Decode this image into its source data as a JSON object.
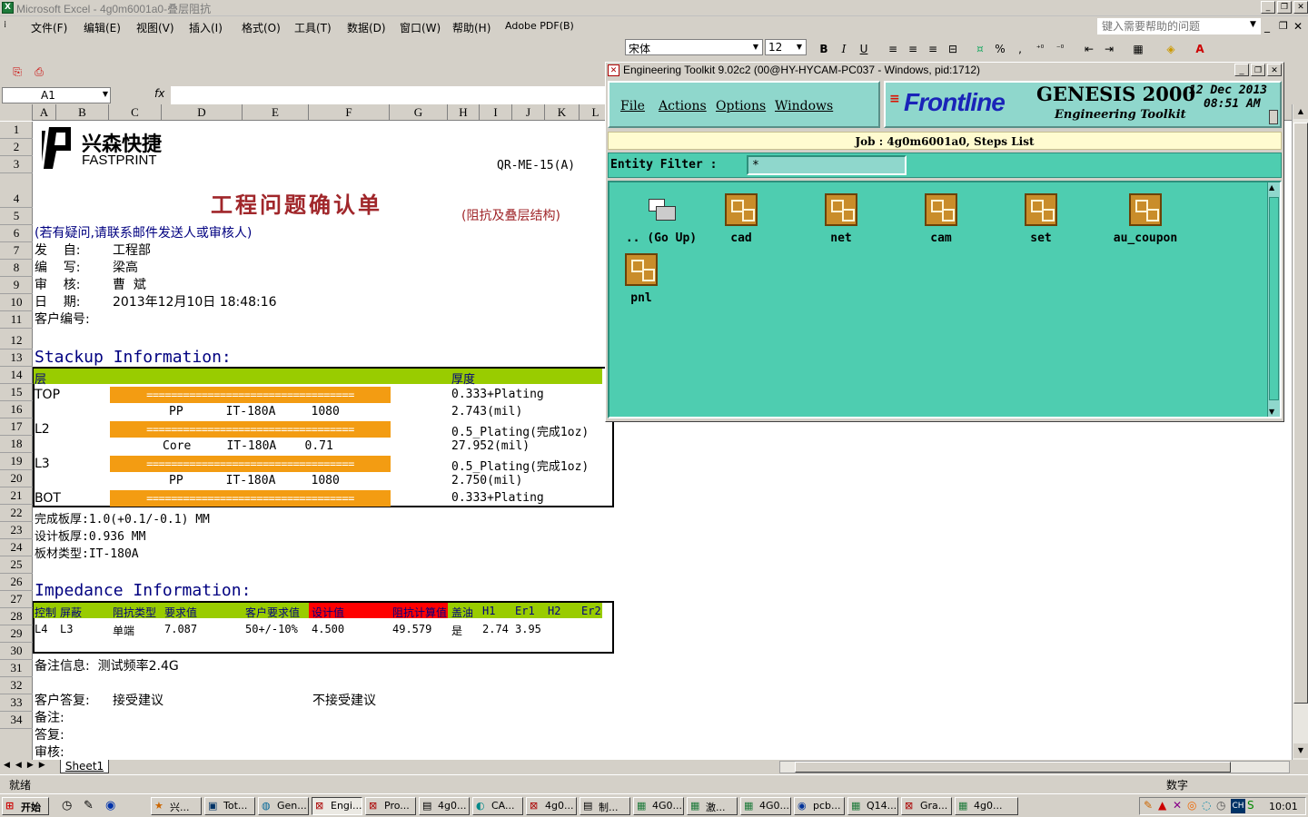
{
  "window": {
    "title": "Microsoft Excel - 4g0m6001a0-叠层阻抗",
    "icon": "excel-icon"
  },
  "menubar": {
    "items": [
      "文件(F)",
      "编辑(E)",
      "视图(V)",
      "插入(I)",
      "格式(O)",
      "工具(T)",
      "数据(D)",
      "窗口(W)",
      "帮助(H)",
      "Adobe PDF(B)"
    ],
    "help_placeholder": "键入需要帮助的问题"
  },
  "format_toolbar": {
    "font": "宋体",
    "size": "12",
    "bold": "B",
    "italic": "I",
    "underline": "U",
    "percent": "%",
    "comma": ","
  },
  "formula_bar": {
    "cell_ref": "A1",
    "fx": "fx",
    "formula": ""
  },
  "columns": [
    "A",
    "B",
    "C",
    "D",
    "E",
    "F",
    "G",
    "H",
    "I",
    "J",
    "K",
    "L"
  ],
  "rows": [
    "1",
    "2",
    "3",
    "4",
    "5",
    "6",
    "7",
    "8",
    "9",
    "10",
    "11",
    "12",
    "13",
    "14",
    "15",
    "16",
    "17",
    "18",
    "19",
    "20",
    "21",
    "22",
    "23",
    "24",
    "25",
    "26",
    "27",
    "28",
    "29",
    "30",
    "31",
    "32",
    "33",
    "34"
  ],
  "sheet": {
    "logo_cn": "兴森快捷",
    "logo_en": "FASTPRINT",
    "form_code": "QR-ME-15(A)",
    "doc_title": "工程问题确认单",
    "doc_subtitle": "(阻抗及叠层结构)",
    "note": "(若有疑问,请联系邮件发送人或审核人)",
    "from_label": "发    自:",
    "from_value": "工程部",
    "author_label": "编    写:",
    "author_value": "梁高",
    "reviewer_label": "审    核:",
    "reviewer_value": "曹  斌",
    "date_label": "日    期:",
    "date_value": "2013年12月10日 18:48:16",
    "customer_no_label": "客户编号:",
    "stackup_heading": "Stackup Information:",
    "stackup_header_layer": "层",
    "stackup_header_thickness": "厚度",
    "stackup_rows": [
      {
        "layer": "TOP",
        "material": "==================================",
        "thickness": "0.333+Plating",
        "kind": "copper"
      },
      {
        "layer": "",
        "material": "PP      IT-180A     1080",
        "thickness": "2.743(mil)",
        "kind": "dielectric"
      },
      {
        "layer": "L2",
        "material": "==================================",
        "thickness": "0.5_Plating(完成1oz)",
        "kind": "copper"
      },
      {
        "layer": "",
        "material": "Core     IT-180A    0.71",
        "thickness": "27.952(mil)",
        "kind": "dielectric"
      },
      {
        "layer": "L3",
        "material": "==================================",
        "thickness": "0.5_Plating(完成1oz)",
        "kind": "copper"
      },
      {
        "layer": "",
        "material": "PP      IT-180A     1080",
        "thickness": "2.750(mil)",
        "kind": "dielectric"
      },
      {
        "layer": "BOT",
        "material": "==================================",
        "thickness": "0.333+Plating",
        "kind": "copper"
      }
    ],
    "finished_thickness": "完成板厚:1.0(+0.1/-0.1) MM",
    "design_thickness": "设计板厚:0.936 MM",
    "board_material": "板材类型:IT-180A",
    "impedance_heading": "Impedance Information:",
    "impedance_headers": [
      "控制",
      "屏蔽",
      "阻抗类型",
      "要求值",
      "客户要求值",
      "设计值",
      "阻抗计算值",
      "盖油",
      "H1",
      "Er1",
      "H2",
      "Er2"
    ],
    "impedance_row": [
      "L4",
      "L3",
      "单端",
      "7.087",
      "50+/-10%",
      "4.500",
      "49.579",
      "是",
      "2.74",
      "3.95",
      "",
      ""
    ],
    "remarks": "备注信息:  测试频率2.4G",
    "customer_reply_label": "客户答复:",
    "accept": "接受建议",
    "reject": "不接受建议",
    "memo_label": "备注:",
    "reply_label": "答复:",
    "review_label": "审核:",
    "sheet_tab": "Sheet1"
  },
  "status": {
    "ready": "就绪",
    "numlock": "数字"
  },
  "genesis": {
    "title": "Engineering Toolkit 9.02c2 (00@HY-HYCAM-PC037 - Windows, pid:1712)",
    "menu": [
      "File",
      "Actions",
      "Options",
      "Windows"
    ],
    "brand": "Frontline",
    "product": "GENESIS 2000",
    "subtitle": "Engineering Toolkit",
    "date": "12 Dec 2013",
    "time": "08:51 AM",
    "job_line": "Job : 4g0m6001a0, Steps List",
    "filter_label": "Entity Filter :",
    "filter_value": "*",
    "steps": [
      ".. (Go Up)",
      "cad",
      "net",
      "cam",
      "set",
      "au_coupon",
      "pnl"
    ]
  },
  "taskbar": {
    "start": "开始",
    "tasks": [
      "兴...",
      "Tot...",
      "Gen...",
      "Engi...",
      "Pro...",
      "4g0...",
      "CA...",
      "4g0...",
      "制...",
      "4G0...",
      "激...",
      "4G0...",
      "pcb...",
      "Q14...",
      "Gra...",
      "4g0..."
    ],
    "lang": "CH",
    "clock": "10:01"
  },
  "colors": {
    "heading_band": "#99cc00",
    "copper_bar": "#f39c12",
    "design_header": "#ff0000",
    "genesis_bg": "#4ecdb0",
    "link_blue": "#000080"
  }
}
